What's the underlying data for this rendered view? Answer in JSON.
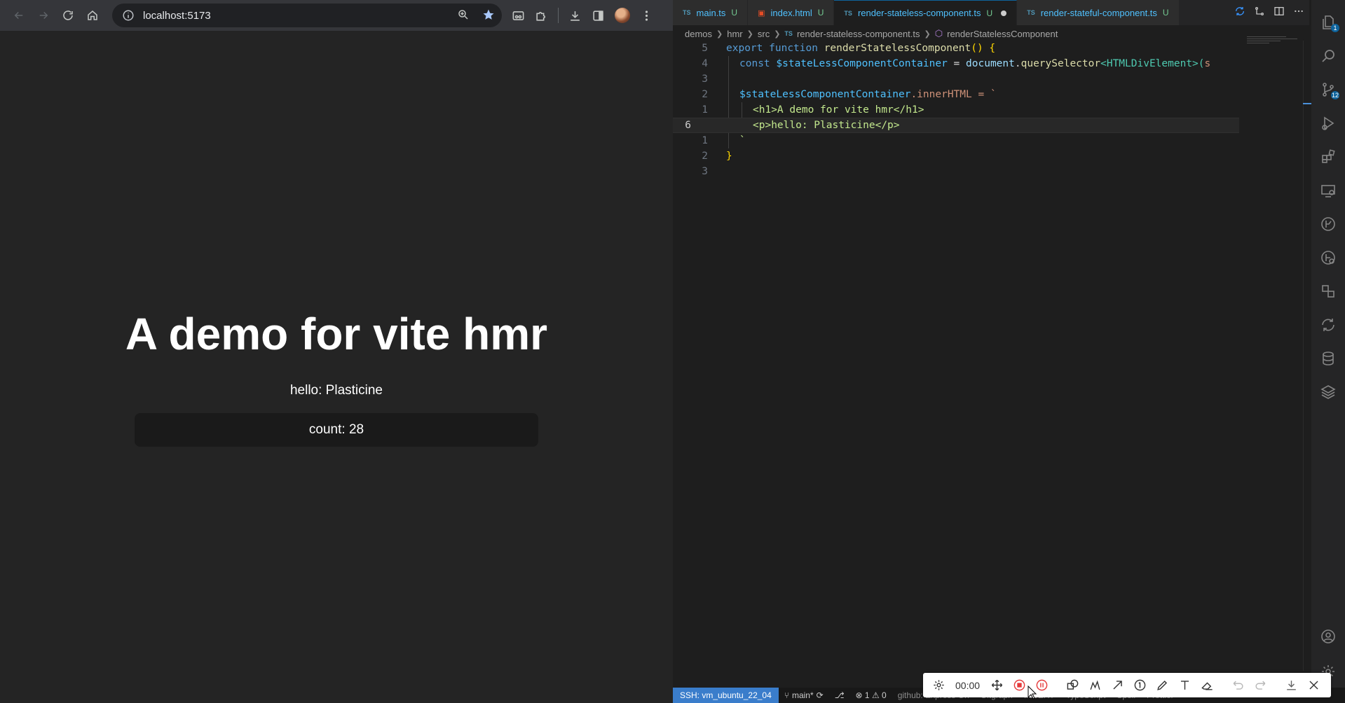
{
  "browser": {
    "url": "localhost:5173",
    "page": {
      "heading": "A demo for vite hmr",
      "greeting": "hello: Plasticine",
      "count_label": "count: 28"
    }
  },
  "vscode": {
    "tabs": [
      {
        "type": "TS",
        "name": "main.ts",
        "status": "U"
      },
      {
        "type": "html",
        "name": "index.html",
        "status": "U"
      },
      {
        "type": "TS",
        "name": "render-stateless-component.ts",
        "status": "U",
        "modified": true,
        "active": true
      },
      {
        "type": "TS",
        "name": "render-stateful-component.ts",
        "status": "U"
      }
    ],
    "breadcrumb": [
      "demos",
      "hmr",
      "src",
      "render-stateless-component.ts",
      "renderStatelessComponent"
    ],
    "breadcrumb_ts": "TS",
    "line_numbers": [
      "5",
      "4",
      "3",
      "2",
      "1",
      "6",
      "1",
      "2",
      "3"
    ],
    "code": {
      "l1_kw1": "export",
      "l1_kw2": "function",
      "l1_fn": "renderStatelessComponent",
      "l1_rest": "() {",
      "l2_kw": "const",
      "l2_var": "$stateLessComponentContainer",
      "l2_eq": " = ",
      "l2_doc": "document",
      "l2_dot": ".",
      "l2_method": "querySelector",
      "l2_gen": "<HTMLDivElement>(",
      "l2_trunc": "s",
      "l4_var": "$stateLessComponentContainer",
      "l4_prop": ".innerHTML",
      "l4_eq": " = `",
      "l5": "<h1>A demo for vite hmr</h1>",
      "l6": "<p>hello: Plasticine</p>",
      "l7": "`",
      "l8": "}"
    },
    "statusbar": {
      "ssh": "SSH: vm_ubuntu_22_04",
      "branch": "main*",
      "problems": "⊗ 1 ⚠ 0",
      "faded": [
        "github: Express On",
        "Gitgraph",
        "INSERT",
        "TypeScript",
        "Spell",
        "Prettier"
      ]
    },
    "activity_badges": {
      "explorer": "1",
      "scm": "12"
    }
  },
  "recorder": {
    "time": "00:00"
  }
}
